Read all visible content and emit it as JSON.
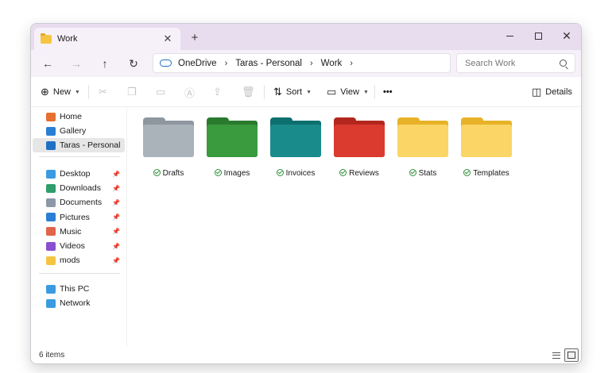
{
  "window": {
    "tab_title": "Work"
  },
  "title_controls": {
    "new_tab": "+",
    "close_tab": "✕"
  },
  "nav": {
    "breadcrumbs": [
      "OneDrive",
      "Taras - Personal",
      "Work"
    ],
    "search_placeholder": "Search Work"
  },
  "toolbar": {
    "new_label": "New",
    "sort_label": "Sort",
    "view_label": "View",
    "more_label": "•••",
    "details_label": "Details"
  },
  "sidebar": {
    "top": [
      {
        "label": "Home",
        "icon": "home-icon",
        "color": "#e6702e"
      },
      {
        "label": "Gallery",
        "icon": "gallery-icon",
        "color": "#2a7fd4"
      },
      {
        "label": "Taras - Personal",
        "icon": "cloud-icon",
        "color": "#1f6fc5"
      }
    ],
    "quick": [
      {
        "label": "Desktop",
        "icon": "desktop-icon",
        "color": "#3a9be0"
      },
      {
        "label": "Downloads",
        "icon": "downloads-icon",
        "color": "#2f9e6b"
      },
      {
        "label": "Documents",
        "icon": "documents-icon",
        "color": "#8a98a8"
      },
      {
        "label": "Pictures",
        "icon": "pictures-icon",
        "color": "#2a7fd4"
      },
      {
        "label": "Music",
        "icon": "music-icon",
        "color": "#e0654a"
      },
      {
        "label": "Videos",
        "icon": "videos-icon",
        "color": "#8a4fd0"
      },
      {
        "label": "mods",
        "icon": "folder-icon",
        "color": "#f5c542"
      }
    ],
    "devices": [
      {
        "label": "This PC",
        "icon": "pc-icon",
        "color": "#3a9be0"
      },
      {
        "label": "Network",
        "icon": "network-icon",
        "color": "#3a9be0"
      }
    ]
  },
  "folders": [
    {
      "label": "Drafts",
      "color_back": "#8e979f",
      "color_front": "#aab2ba"
    },
    {
      "label": "Images",
      "color_back": "#2a7a2e",
      "color_front": "#3a9a3e"
    },
    {
      "label": "Invoices",
      "color_back": "#0e6f6f",
      "color_front": "#1a8b8b"
    },
    {
      "label": "Reviews",
      "color_back": "#b3261e",
      "color_front": "#db3a2f"
    },
    {
      "label": "Stats",
      "color_back": "#e8b228",
      "color_front": "#fbd566"
    },
    {
      "label": "Templates",
      "color_back": "#e8b228",
      "color_front": "#fbd566"
    }
  ],
  "status": {
    "item_count": "6 items"
  }
}
